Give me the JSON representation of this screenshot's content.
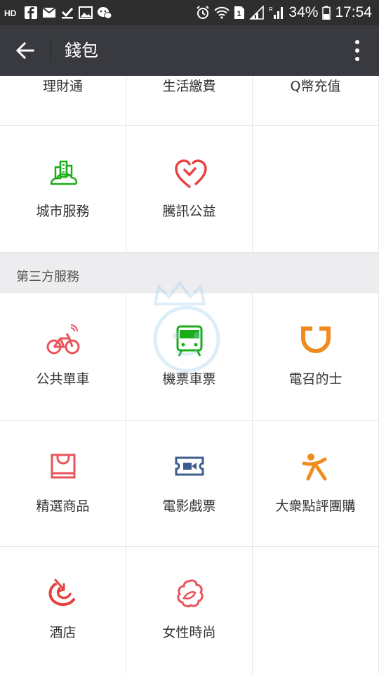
{
  "status_bar": {
    "battery_percent": "34%",
    "time": "17:54"
  },
  "app_bar": {
    "title": "錢包",
    "back_icon": "arrow-left-icon",
    "menu_icon": "more-vertical-icon"
  },
  "top_row": {
    "items": [
      {
        "label": "理財通"
      },
      {
        "label": "生活繳費"
      },
      {
        "label": "Q幣充值"
      }
    ]
  },
  "row_2": {
    "items": [
      {
        "label": "城市服務",
        "icon": "city-icon",
        "color": "#1aad19"
      },
      {
        "label": "騰訊公益",
        "icon": "charity-heart-icon",
        "color": "#e64340"
      }
    ]
  },
  "third_party": {
    "header": "第三方服務",
    "rows": [
      [
        {
          "label": "公共單車",
          "icon": "bicycle-icon",
          "color": "#e9545a"
        },
        {
          "label": "機票車票",
          "icon": "train-icon",
          "color": "#1aad19"
        },
        {
          "label": "電召的士",
          "icon": "didi-taxi-icon",
          "color": "#f08c1f"
        }
      ],
      [
        {
          "label": "精選商品",
          "icon": "shopping-bag-icon",
          "color": "#e9545a"
        },
        {
          "label": "電影戲票",
          "icon": "movie-ticket-icon",
          "color": "#3f5c8e"
        },
        {
          "label": "大衆點評團購",
          "icon": "dianping-icon",
          "color": "#f08c1f"
        }
      ],
      [
        {
          "label": "酒店",
          "icon": "hotel-icon",
          "color": "#e64340"
        },
        {
          "label": "女性時尚",
          "icon": "flower-icon",
          "color": "#e9545a"
        }
      ]
    ]
  }
}
